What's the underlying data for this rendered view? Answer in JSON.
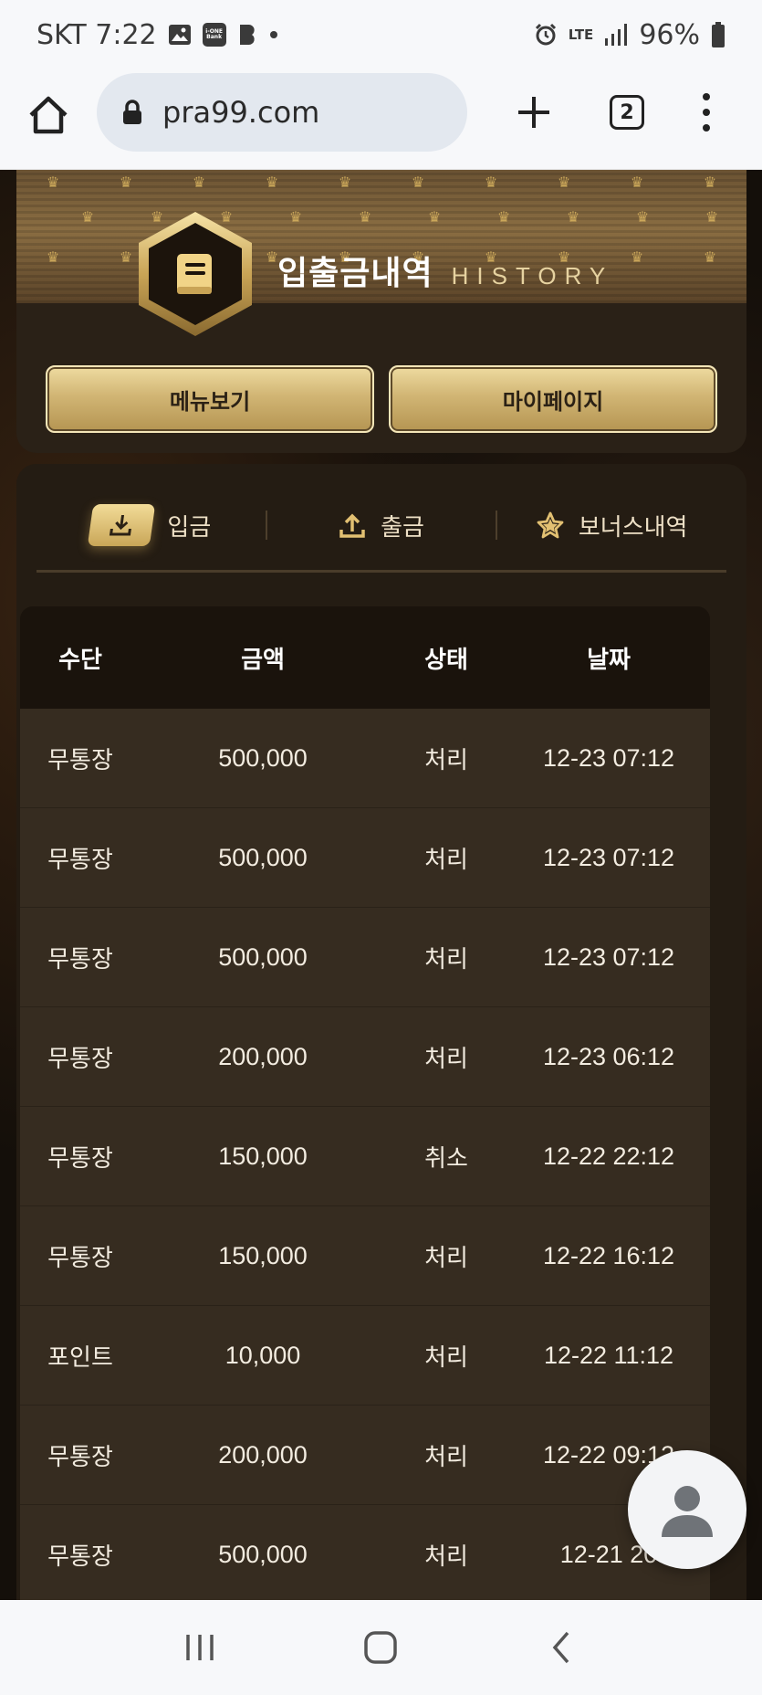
{
  "status_bar": {
    "carrier_time": "SKT 7:22",
    "app_icon_label": "i-ONE Bank",
    "network": "LTE",
    "battery": "96%"
  },
  "browser": {
    "url": "pra99.com",
    "tab_count": "2"
  },
  "header": {
    "title_ko": "입출금내역",
    "title_en": "HISTORY",
    "menu_button": "메뉴보기",
    "mypage_button": "마이페이지"
  },
  "tabs": [
    {
      "label": "입금",
      "icon": "download-icon",
      "active": true
    },
    {
      "label": "출금",
      "icon": "upload-icon",
      "active": false
    },
    {
      "label": "보너스내역",
      "icon": "star-icon",
      "active": false
    }
  ],
  "table": {
    "headers": [
      "수단",
      "금액",
      "상태",
      "날짜"
    ],
    "rows": [
      [
        "무통장",
        "500,000",
        "처리",
        "12-23 07:12"
      ],
      [
        "무통장",
        "500,000",
        "처리",
        "12-23 07:12"
      ],
      [
        "무통장",
        "500,000",
        "처리",
        "12-23 07:12"
      ],
      [
        "무통장",
        "200,000",
        "처리",
        "12-23 06:12"
      ],
      [
        "무통장",
        "150,000",
        "취소",
        "12-22 22:12"
      ],
      [
        "무통장",
        "150,000",
        "처리",
        "12-22 16:12"
      ],
      [
        "포인트",
        "10,000",
        "처리",
        "12-22 11:12"
      ],
      [
        "무통장",
        "200,000",
        "처리",
        "12-22 09:12"
      ],
      [
        "무통장",
        "500,000",
        "처리",
        "12-21 20"
      ]
    ]
  },
  "colors": {
    "gold_accent": "#d1b574",
    "panel_bg": "#241c13",
    "row_bg": "#362c20",
    "header_bg": "#1a130c"
  }
}
